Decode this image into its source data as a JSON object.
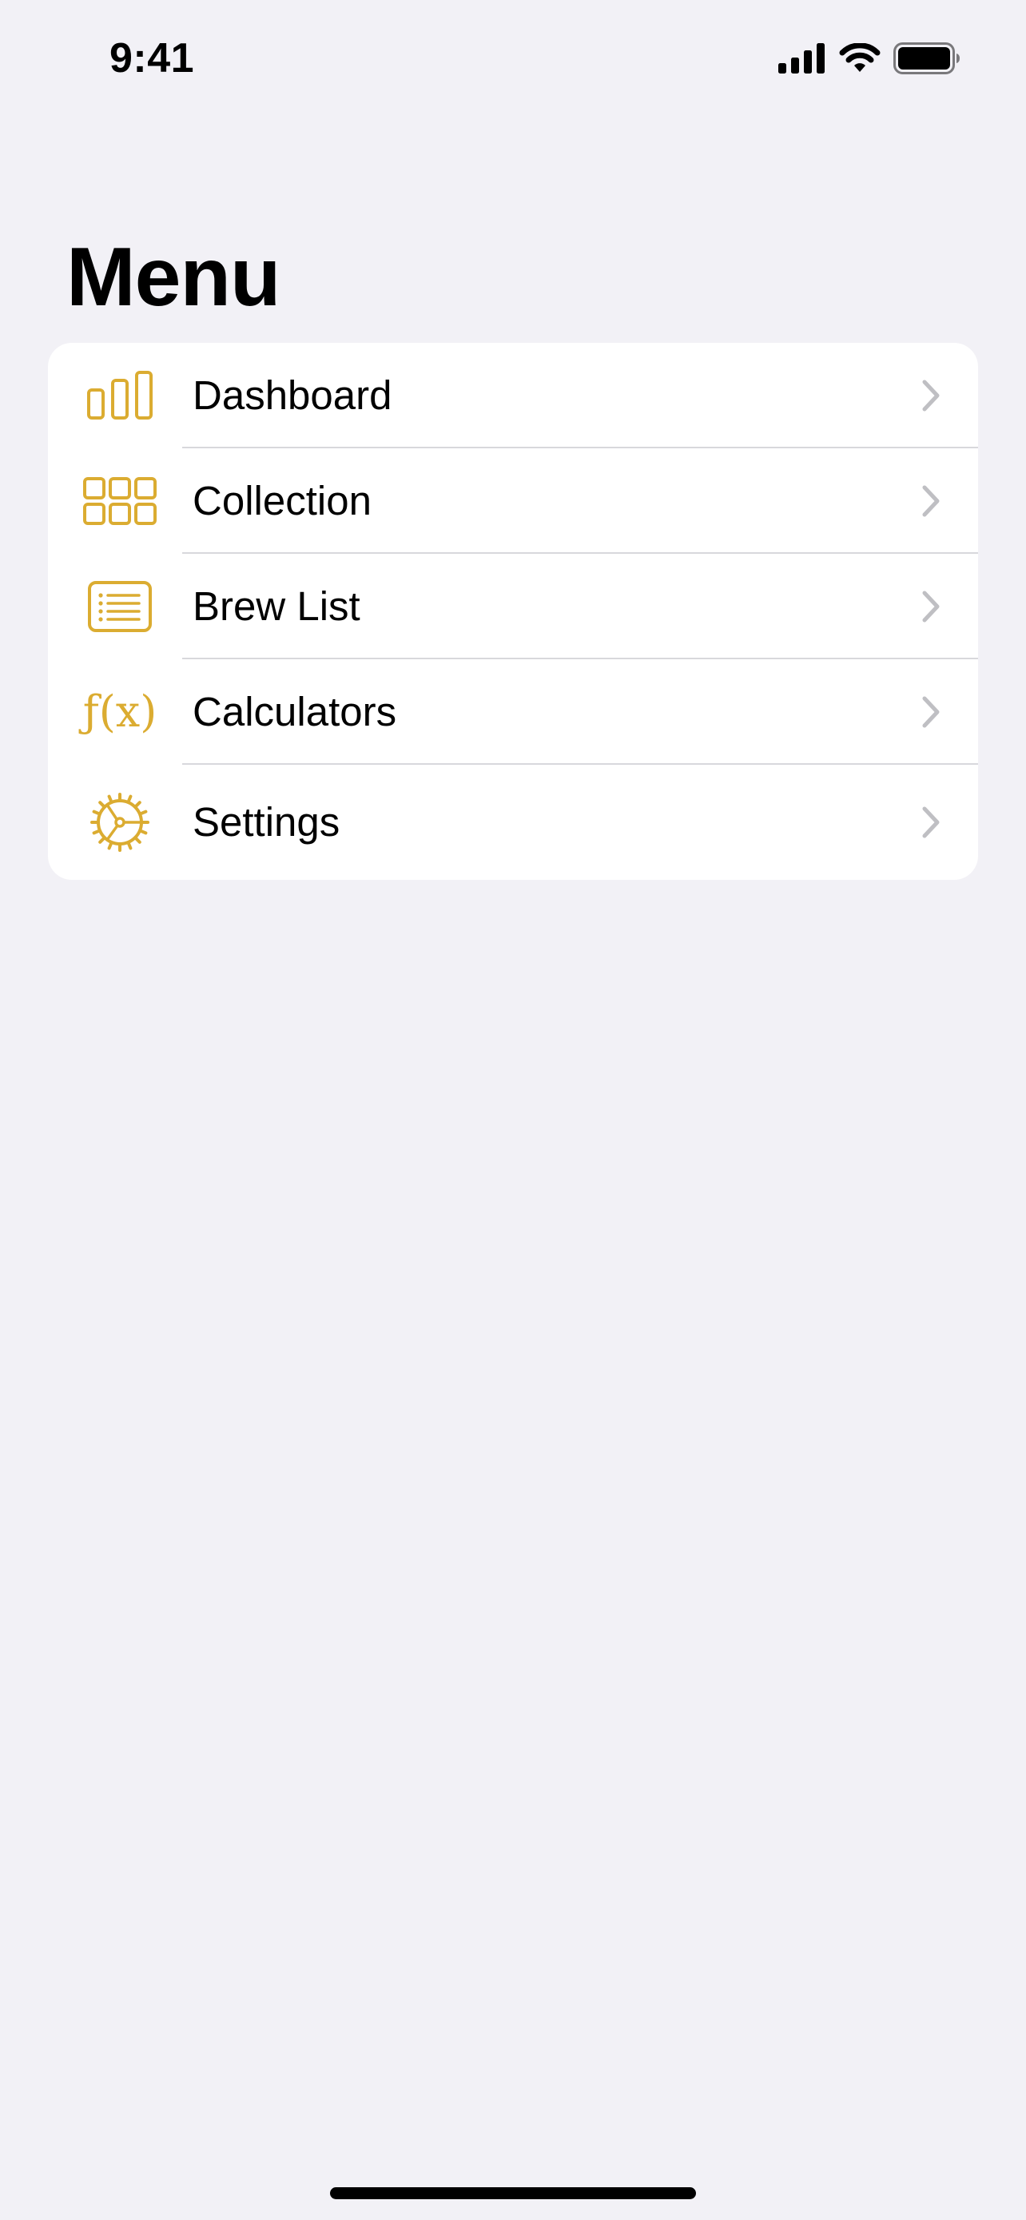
{
  "status_bar": {
    "time": "9:41"
  },
  "page": {
    "title": "Menu"
  },
  "colors": {
    "accent": "#dbac31",
    "background": "#f2f1f6",
    "card": "#ffffff",
    "chevron": "#bfbfc3",
    "divider": "#d8d8dc"
  },
  "menu": {
    "items": [
      {
        "label": "Dashboard",
        "icon": "bar-chart-icon"
      },
      {
        "label": "Collection",
        "icon": "grid-icon"
      },
      {
        "label": "Brew List",
        "icon": "list-icon"
      },
      {
        "label": "Calculators",
        "icon": "function-icon",
        "icon_text": "ƒ(x)"
      },
      {
        "label": "Settings",
        "icon": "gear-icon"
      }
    ]
  }
}
